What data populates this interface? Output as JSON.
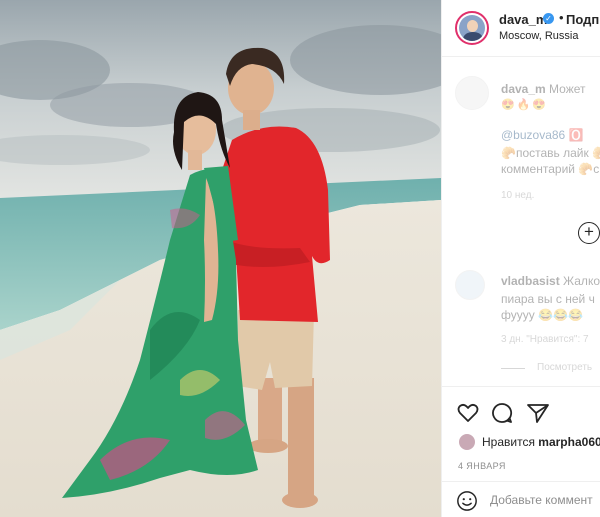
{
  "header": {
    "username": "dava_m",
    "verified_icon": "verified-badge-icon",
    "separator": "•",
    "follow_label": "Подп",
    "location": "Moscow, Russia"
  },
  "comments": [
    {
      "username": "dava_m",
      "text_start": "Может",
      "emojis": "😍🔥😍",
      "lines": [
        "@buzova86 🅾️",
        "🥐поставь лайк 🥐",
        "комментарий 🥐с"
      ],
      "time": "10 нед."
    },
    {
      "username": "vladbasist",
      "lines": [
        "Жалко",
        "пиара вы с ней ч",
        "фуууу 😂😂😂"
      ],
      "meta": "3 дн.  \"Нравится\": 7",
      "more": "Посмотреть"
    }
  ],
  "actions": {
    "likes_prefix": "Нравится",
    "likes_user": "marpha060",
    "date": "4 января",
    "add_comment_placeholder": "Добавьте коммент"
  },
  "colors": {
    "story_ring": "#e0306b",
    "verified": "#3897f0",
    "muted": "#8e8e8e"
  }
}
